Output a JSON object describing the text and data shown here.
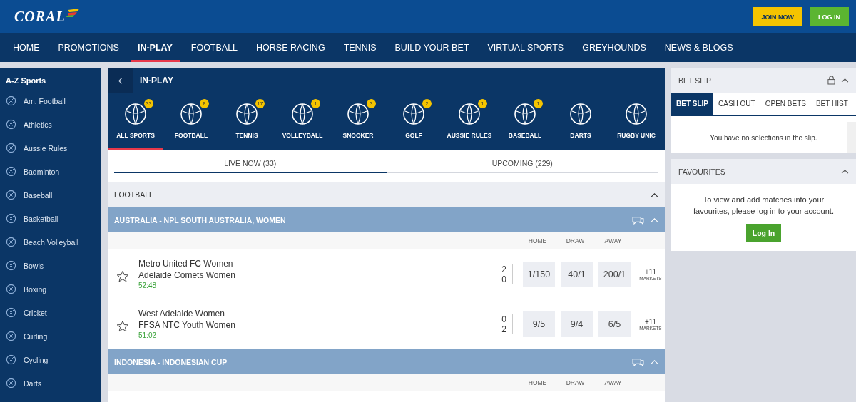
{
  "header": {
    "logo": "CORAL",
    "buttons": [
      {
        "label": "JOIN NOW",
        "kind": "join"
      },
      {
        "label": "LOG IN",
        "kind": "login"
      }
    ]
  },
  "nav": [
    {
      "label": "HOME",
      "selected": false
    },
    {
      "label": "PROMOTIONS",
      "selected": false
    },
    {
      "label": "IN-PLAY",
      "selected": true
    },
    {
      "label": "FOOTBALL",
      "selected": false
    },
    {
      "label": "HORSE RACING",
      "selected": false
    },
    {
      "label": "TENNIS",
      "selected": false
    },
    {
      "label": "BUILD YOUR BET",
      "selected": false
    },
    {
      "label": "VIRTUAL SPORTS",
      "selected": false
    },
    {
      "label": "GREYHOUNDS",
      "selected": false
    },
    {
      "label": "NEWS & BLOGS",
      "selected": false
    }
  ],
  "sidebar": {
    "title": "A-Z Sports",
    "items": [
      "Am. Football",
      "Athletics",
      "Aussie Rules",
      "Badminton",
      "Baseball",
      "Basketball",
      "Beach Volleyball",
      "Bowls",
      "Boxing",
      "Cricket",
      "Curling",
      "Cycling",
      "Darts"
    ]
  },
  "inplay": {
    "title": "IN-PLAY",
    "sports": [
      {
        "label": "ALL SPORTS",
        "count": "33",
        "selected": true
      },
      {
        "label": "FOOTBALL",
        "count": "8",
        "selected": false
      },
      {
        "label": "TENNIS",
        "count": "17",
        "selected": false
      },
      {
        "label": "VOLLEYBALL",
        "count": "1",
        "selected": false
      },
      {
        "label": "SNOOKER",
        "count": "3",
        "selected": false
      },
      {
        "label": "GOLF",
        "count": "2",
        "selected": false
      },
      {
        "label": "AUSSIE RULES",
        "count": "1",
        "selected": false
      },
      {
        "label": "BASEBALL",
        "count": "1",
        "selected": false
      },
      {
        "label": "DARTS",
        "selected": false
      },
      {
        "label": "RUGBY UNIC",
        "selected": false
      }
    ],
    "tabs": [
      {
        "label": "LIVE NOW (33)",
        "selected": true
      },
      {
        "label": "UPCOMING (229)",
        "selected": false
      }
    ],
    "section": "FOOTBALL",
    "leagues": [
      {
        "name": "AUSTRALIA - NPL SOUTH AUSTRALIA, WOMEN",
        "columns": [
          "HOME",
          "DRAW",
          "AWAY"
        ],
        "matches": [
          {
            "home": "Metro United FC Women",
            "away": "Adelaide Comets Women",
            "home_score": "2",
            "away_score": "0",
            "time": "52:48",
            "odds": [
              "1/150",
              "40/1",
              "200/1"
            ],
            "markets_count": "+11",
            "markets_label": "MARKETS"
          },
          {
            "home": "West Adelaide Women",
            "away": "FFSA NTC Youth Women",
            "home_score": "0",
            "away_score": "2",
            "time": "51:02",
            "odds": [
              "9/5",
              "9/4",
              "6/5"
            ],
            "markets_count": "+11",
            "markets_label": "MARKETS"
          }
        ]
      },
      {
        "name": "INDONESIA - INDONESIAN CUP",
        "columns": [
          "HOME",
          "DRAW",
          "AWAY"
        ]
      }
    ]
  },
  "betslip": {
    "title": "BET SLIP",
    "tabs": [
      {
        "label": "BET SLIP",
        "selected": true
      },
      {
        "label": "CASH OUT",
        "selected": false
      },
      {
        "label": "OPEN BETS",
        "selected": false
      },
      {
        "label": "BET HIST",
        "selected": false
      }
    ],
    "empty": "You have no selections in the slip."
  },
  "favourites": {
    "title": "FAVOURITES",
    "text": "To view and add matches into your favourites, please log in to your account.",
    "button": "Log In"
  }
}
